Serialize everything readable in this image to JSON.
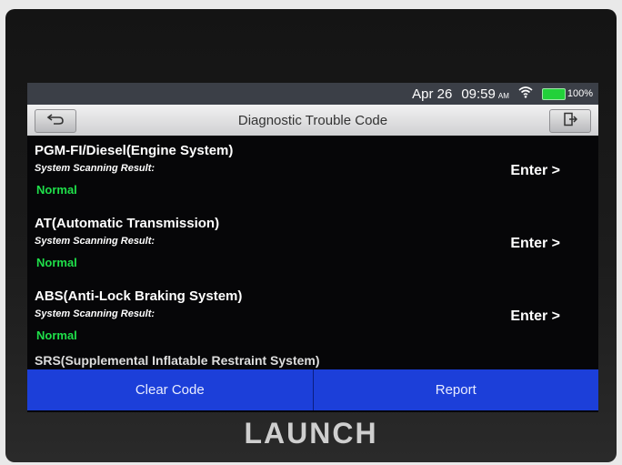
{
  "status_bar": {
    "date": "Apr 26",
    "time": "09:59",
    "ampm": "AM",
    "battery": "100%",
    "battery_level": 1.0,
    "wifi_icon": "wifi-icon"
  },
  "header": {
    "title": "Diagnostic Trouble Code",
    "back_icon": "back-arrow-icon",
    "exit_icon": "exit-icon"
  },
  "systems": [
    {
      "name": "PGM-FI/Diesel(Engine System)",
      "subtitle": "System Scanning Result:",
      "result": "Normal",
      "enter": "Enter >"
    },
    {
      "name": "AT(Automatic Transmission)",
      "subtitle": "System Scanning Result:",
      "result": "Normal",
      "enter": "Enter >"
    },
    {
      "name": "ABS(Anti-Lock Braking System)",
      "subtitle": "System Scanning Result:",
      "result": "Normal",
      "enter": "Enter >"
    }
  ],
  "partial_item": "SRS(Supplemental Inflatable Restraint System)",
  "footer": {
    "clear_label": "Clear Code",
    "report_label": "Report"
  },
  "colors": {
    "normal": "#1fe04a",
    "accent": "#1c3fd9"
  },
  "brand": "LAUNCH"
}
